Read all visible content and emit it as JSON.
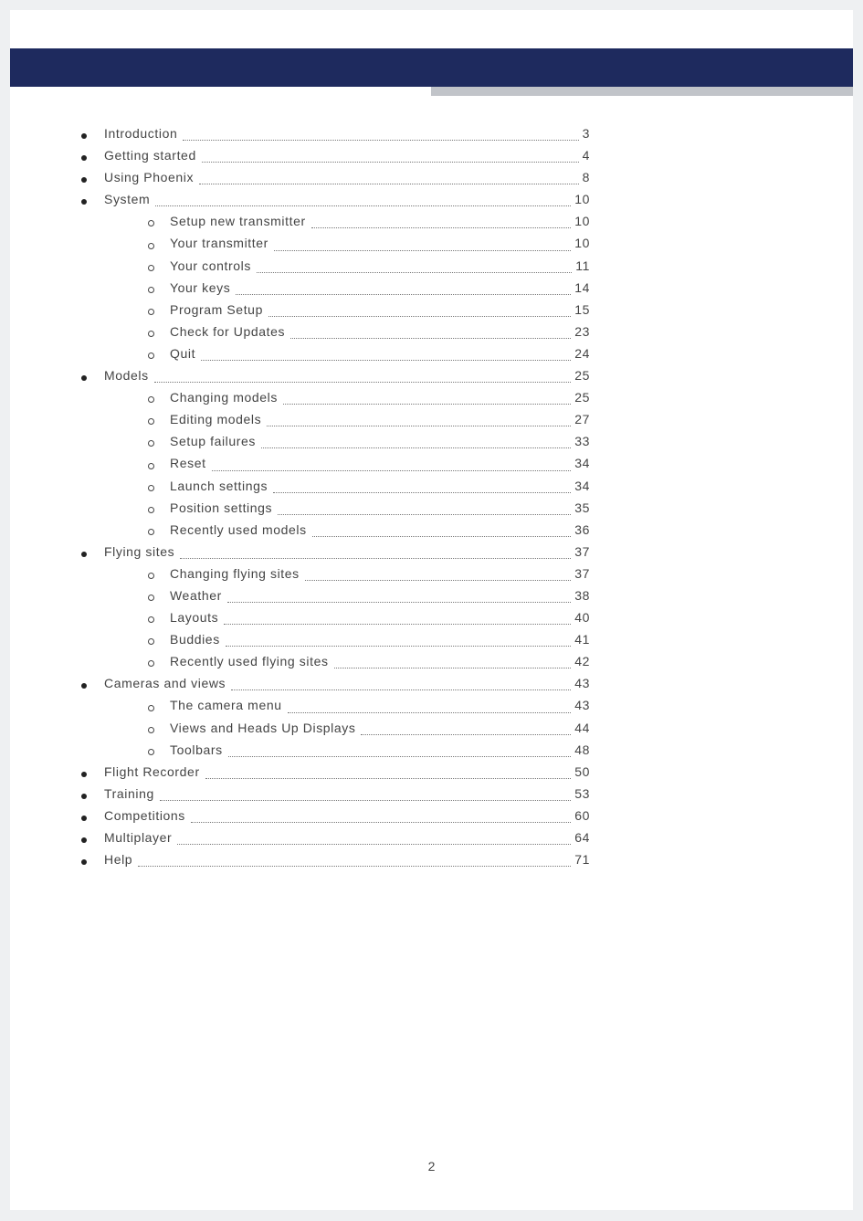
{
  "page_number": "2",
  "toc": [
    {
      "level": 1,
      "label": "Introduction",
      "page": "3"
    },
    {
      "level": 1,
      "label": "Getting started",
      "page": "4"
    },
    {
      "level": 1,
      "label": "Using Phoenix",
      "page": "8"
    },
    {
      "level": 1,
      "label": "System",
      "page": "10"
    },
    {
      "level": 2,
      "label": "Setup new transmitter",
      "page": "10"
    },
    {
      "level": 2,
      "label": "Your transmitter",
      "page": "10"
    },
    {
      "level": 2,
      "label": "Your controls",
      "page": "11"
    },
    {
      "level": 2,
      "label": "Your keys",
      "page": "14"
    },
    {
      "level": 2,
      "label": "Program Setup",
      "page": "15"
    },
    {
      "level": 2,
      "label": "Check for Updates",
      "page": "23"
    },
    {
      "level": 2,
      "label": "Quit",
      "page": "24"
    },
    {
      "level": 1,
      "label": "Models",
      "page": "25"
    },
    {
      "level": 2,
      "label": "Changing models",
      "page": "25"
    },
    {
      "level": 2,
      "label": "Editing models",
      "page": "27"
    },
    {
      "level": 2,
      "label": "Setup failures",
      "page": "33"
    },
    {
      "level": 2,
      "label": "Reset",
      "page": "34"
    },
    {
      "level": 2,
      "label": "Launch settings",
      "page": "34"
    },
    {
      "level": 2,
      "label": "Position settings",
      "page": "35"
    },
    {
      "level": 2,
      "label": "Recently used models",
      "page": "36"
    },
    {
      "level": 1,
      "label": "Flying sites",
      "page": "37"
    },
    {
      "level": 2,
      "label": "Changing flying sites",
      "page": "37"
    },
    {
      "level": 2,
      "label": "Weather",
      "page": "38"
    },
    {
      "level": 2,
      "label": "Layouts",
      "page": "40"
    },
    {
      "level": 2,
      "label": "Buddies",
      "page": "41"
    },
    {
      "level": 2,
      "label": "Recently used flying sites",
      "page": "42"
    },
    {
      "level": 1,
      "label": "Cameras and views",
      "page": "43"
    },
    {
      "level": 2,
      "label": "The camera menu",
      "page": "43"
    },
    {
      "level": 2,
      "label": "Views and Heads Up Displays",
      "page": "44"
    },
    {
      "level": 2,
      "label": "Toolbars",
      "page": "48"
    },
    {
      "level": 1,
      "label": "Flight Recorder",
      "page": "50"
    },
    {
      "level": 1,
      "label": "Training",
      "page": "53"
    },
    {
      "level": 1,
      "label": "Competitions",
      "page": "60"
    },
    {
      "level": 1,
      "label": "Multiplayer",
      "page": "64"
    },
    {
      "level": 1,
      "label": "Help",
      "page": "71"
    }
  ]
}
